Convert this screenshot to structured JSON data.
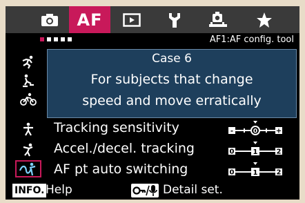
{
  "tabs": [
    {
      "icon": "camera-icon"
    },
    {
      "label": "AF",
      "active": true
    },
    {
      "icon": "playback-icon"
    },
    {
      "icon": "wrench-icon"
    },
    {
      "icon": "custom-function-icon"
    },
    {
      "icon": "star-icon"
    }
  ],
  "header": {
    "page_dots_total": 4,
    "page_dots_active": 1,
    "subtitle": "AF1:AF config. tool"
  },
  "cases": [
    {
      "icon": "case1-runner-icon"
    },
    {
      "icon": "case2-skater-icon"
    },
    {
      "icon": "case3-cyclist-icon"
    },
    {
      "icon": "case4-figure-icon"
    },
    {
      "icon": "case5-gymnast-icon"
    },
    {
      "icon": "case6-erratic-icon",
      "selected": true
    }
  ],
  "description": {
    "case_title": "Case 6",
    "line1": "For subjects that change",
    "line2": "speed and move erratically"
  },
  "params": [
    {
      "label": "Tracking sensitivity",
      "scale_left": "-",
      "scale_right": "+",
      "value": 0
    },
    {
      "label": "Accel./decel. tracking",
      "scale_left": "0",
      "scale_right": "2",
      "value": 1
    },
    {
      "label": "AF pt auto switching",
      "scale_left": "0",
      "scale_right": "2",
      "value": 1
    }
  ],
  "footer": {
    "info_label": "INFO.",
    "help_label": "Help",
    "detail_label": "Detail set."
  },
  "colors": {
    "accent": "#c8195a",
    "description_bg": "#1e3f5c",
    "tab_bar": "#3a3a3a"
  }
}
